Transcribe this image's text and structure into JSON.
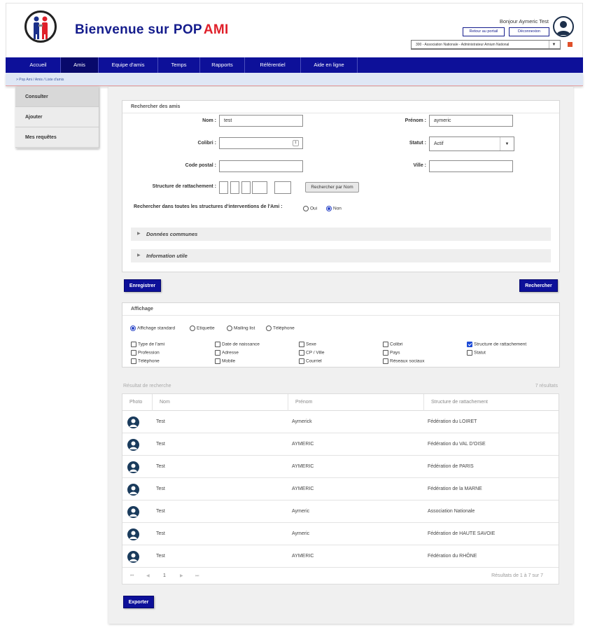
{
  "header": {
    "brand_prefix": "Bienvenue sur",
    "brand_pop": "POP",
    "brand_ami": "AMI",
    "greeting": "Bonjour Aymeric Test",
    "back_portal": "Retour au portail",
    "logout": "Déconnexion",
    "association": "300 - Association Nationale - Administrateur Amium National"
  },
  "nav": {
    "items": [
      "Accueil",
      "Amis",
      "Equipe d'amis",
      "Temps",
      "Rapports",
      "Référentiel",
      "Aide en ligne"
    ],
    "active": "Amis"
  },
  "breadcrumb": "> Pop Ami / Amis / Liste d'amis",
  "leftmenu": {
    "items": [
      "Consulter",
      "Ajouter",
      "Mes requêtes"
    ]
  },
  "search": {
    "title": "Rechercher des amis",
    "nom_label": "Nom :",
    "nom_value": "test",
    "prenom_label": "Prénom :",
    "prenom_value": "aymeric",
    "colibri_label": "Colibri :",
    "colibri_value": "",
    "statut_label": "Statut :",
    "statut_value": "Actif",
    "cp_label": "Code postal :",
    "cp_value": "",
    "ville_label": "Ville :",
    "ville_value": "",
    "structure_label": "Structure de rattachement :",
    "search_by_name": "Rechercher par Nom",
    "all_structures_label": "Rechercher dans toutes les structures d'interventions de l'Ami :",
    "oui": "Oui",
    "non": "Non",
    "non_selected": true,
    "accordion_1": "Données communes",
    "accordion_2": "Information utile"
  },
  "buttons": {
    "save": "Enregistrer",
    "search": "Rechercher",
    "export": "Exporter"
  },
  "display": {
    "title": "Affichage",
    "modes": [
      "Affichage standard",
      "Etiquette",
      "Mailing list",
      "Téléphone"
    ],
    "selected_mode": "Affichage standard",
    "columns": [
      {
        "label": "Type de l'ami",
        "checked": false
      },
      {
        "label": "Date de naissance",
        "checked": false
      },
      {
        "label": "Sexe",
        "checked": false
      },
      {
        "label": "Colibri",
        "checked": false
      },
      {
        "label": "Structure de rattachement",
        "checked": true
      },
      {
        "label": "Profession",
        "checked": false
      },
      {
        "label": "Adresse",
        "checked": false
      },
      {
        "label": "CP / Ville",
        "checked": false
      },
      {
        "label": "Pays",
        "checked": false
      },
      {
        "label": "Statut",
        "checked": false
      },
      {
        "label": "Téléphone",
        "checked": false
      },
      {
        "label": "Mobile",
        "checked": false
      },
      {
        "label": "Courriel",
        "checked": false
      },
      {
        "label": "Réseaux sociaux",
        "checked": false
      }
    ]
  },
  "results": {
    "label": "Résultat de recherche",
    "count": "7 résultats",
    "headers": [
      "Photo",
      "Nom",
      "Prénom",
      "Structure de rattachement"
    ],
    "rows": [
      {
        "nom": "Test",
        "prenom": "Aymerick",
        "structure": "Fédération du LOIRET"
      },
      {
        "nom": "Test",
        "prenom": "AYMERIC",
        "structure": "Fédération du VAL D'OISE"
      },
      {
        "nom": "Test",
        "prenom": "AYMERIC",
        "structure": "Fédération de PARIS"
      },
      {
        "nom": "Test",
        "prenom": "AYMERIC",
        "structure": "Fédération de la MARNE"
      },
      {
        "nom": "Test",
        "prenom": "Aymeric",
        "structure": "Association Nationale"
      },
      {
        "nom": "Test",
        "prenom": "Aymeric",
        "structure": "Fédération de HAUTE SAVOIE"
      },
      {
        "nom": "Test",
        "prenom": "AYMERIC",
        "structure": "Fédération du RHÔNE"
      }
    ],
    "pager": {
      "first": "⏮",
      "prev": "◀",
      "page": "1",
      "next": "▶",
      "last": "⏭",
      "summary": "Résultats de 1 à 7 sur 7"
    }
  },
  "colors": {
    "brand_blue": "#141c8c",
    "nav_blue": "#0d1099",
    "brand_red": "#e0202a"
  }
}
